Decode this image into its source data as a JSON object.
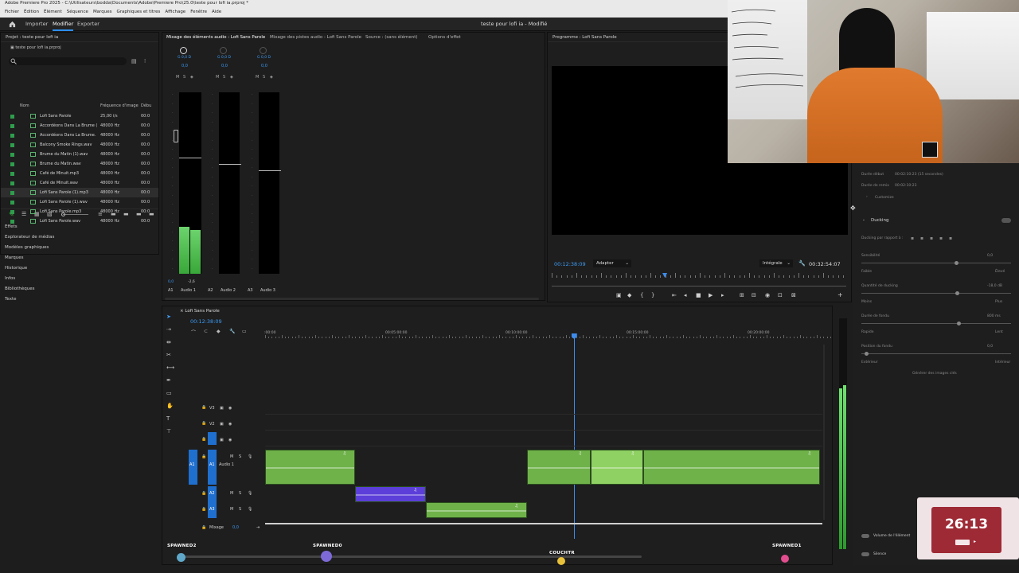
{
  "window": {
    "title": "Adobe Premiere Pro 2025 - C:\\Utilisateurs\\bodda\\Documents\\Adobe\\Premiere Pro\\25.0\\teste pour lofi ia.prproj *"
  },
  "menu": [
    "Fichier",
    "Édition",
    "Élément",
    "Séquence",
    "Marques",
    "Graphiques et titres",
    "Affichage",
    "Fenêtre",
    "Aide"
  ],
  "appbar": {
    "workspaces": [
      "Importer",
      "Modifier",
      "Exporter"
    ],
    "active_workspace": "Modifier",
    "document_title": "teste pour lofi ia - Modifié"
  },
  "project": {
    "header": "Projet : teste pour lofi ia",
    "file": "teste pour lofi ia.prproj",
    "columns": {
      "name": "Nom",
      "rate": "Fréquence d'image",
      "start": "Débu"
    },
    "items": [
      {
        "name": "Lofi Sans Parole",
        "rate": "25,00 i/s",
        "start": "00:0"
      },
      {
        "name": "Accordéons Dans La Brume (",
        "rate": "48000  Hz",
        "start": "00:0"
      },
      {
        "name": "Accordéons Dans La Brume.",
        "rate": "48000  Hz",
        "start": "00:0"
      },
      {
        "name": "Balcony Smoke Rings.wav",
        "rate": "48000  Hz",
        "start": "00:0"
      },
      {
        "name": "Brume du Matin (1).wav",
        "rate": "48000  Hz",
        "start": "00:0"
      },
      {
        "name": "Brume du Matin.wav",
        "rate": "48000  Hz",
        "start": "00:0"
      },
      {
        "name": "Café de Minuit.mp3",
        "rate": "48000  Hz",
        "start": "00:0"
      },
      {
        "name": "Café de Minuit.wav",
        "rate": "48000  Hz",
        "start": "00:0"
      },
      {
        "name": "Lofi Sans Parole (1).mp3",
        "rate": "48000  Hz",
        "start": "00:0"
      },
      {
        "name": "Lofi Sans Parole (1).wav",
        "rate": "48000  Hz",
        "start": "00:0"
      },
      {
        "name": "Lofi Sans Parole.mp3",
        "rate": "48000  Hz",
        "start": "00:0"
      },
      {
        "name": "Lofi Sans Parole.wav",
        "rate": "48000  Hz",
        "start": "00:0"
      }
    ]
  },
  "panels_list": [
    "Effets",
    "Explorateur de médias",
    "Modèles graphiques",
    "Marques",
    "Historique",
    "Infos",
    "Bibliothèques",
    "Texte"
  ],
  "audio_mixer": {
    "tabs": [
      "Mixage des éléments audio : Lofi Sans Parole",
      "Mixage des pistes audio : Lofi Sans Parole",
      "Source : (sans élément)",
      "Options d'effet"
    ],
    "channels": [
      {
        "id": "A1",
        "name": "Audio 1",
        "value": "0,0",
        "level": 0.26
      },
      {
        "id": "A2",
        "name": "Audio 2",
        "value": "0,0",
        "level": 0
      },
      {
        "id": "A3",
        "name": "Audio 3",
        "value": "0,0",
        "level": 0
      }
    ],
    "master_value": "0,0",
    "peak_value": "-2,6",
    "knob_label": "G  0,0  D",
    "msb": [
      "M",
      "S",
      "◈"
    ]
  },
  "program": {
    "header": "Programme : Lofi Sans Parole",
    "timecode": "00:12:38:09",
    "fit": "Adapter",
    "quality": "Intégrale",
    "duration": "00:32:54:07",
    "playhead_fraction": 0.384
  },
  "effects_panel": {
    "duree_debut_label": "Durée début",
    "duree_debut_value": "00:02:10:23   (15 secondes)",
    "duree_fin_label": "Durée de remix",
    "duree_fin_value": "00:02:10:23",
    "customize": "Customize",
    "ducking": "Ducking",
    "ducking_target": "Ducking par rapport à :",
    "sensibilite": "Sensibilité",
    "sensibilite_val": "0,0",
    "faible": "Faible",
    "eleve": "Élevé",
    "quantite": "Quantité de ducking",
    "quantite_val": "-18,0 dB",
    "moins": "Moins",
    "plus": "Plus",
    "duree_fondu": "Durée de fondu",
    "duree_fondu_val": "800 ms",
    "rapide": "Rapide",
    "lent": "Lent",
    "position_fondu": "Position du fondu",
    "position_fondu_val": "0,0",
    "exterieur1": "Extérieur",
    "interieur": "Intérieur",
    "generer": "Générer des images clés",
    "volume_element": "Volume de l'élément",
    "silence": "Silence"
  },
  "timeline": {
    "sequence_tab": "Lofi Sans Parole",
    "timecode": "00:12:38:09",
    "ruler": [
      ":00:00",
      "00:05:00:00",
      "00:10:00:00",
      "00:15:00:00",
      "00:20:00:00"
    ],
    "video_tracks": [
      "V3",
      "V2",
      "V1"
    ],
    "audio_tracks": [
      {
        "src": "A1",
        "id": "A1",
        "name": "Audio 1"
      },
      {
        "src": "",
        "id": "A2",
        "name": ""
      },
      {
        "src": "",
        "id": "A3",
        "name": ""
      }
    ],
    "mix_label": "Mixage",
    "mix_value": "0,0",
    "playhead_fraction": 0.554
  },
  "overlays": {
    "spawned2": "SPAWNED2",
    "spawned0": "SPAWNED0",
    "couch": "COUCHTR",
    "spawned1": "SPAWNED1"
  },
  "clock_overlay": {
    "time": "26:13"
  },
  "colors": {
    "audio_clip": "#6fb24a",
    "audio_clip_alt": "#5b3fd8",
    "accent": "#2c8ff0",
    "playhead": "#3d8bea",
    "meter_green": "#4fc04f"
  }
}
